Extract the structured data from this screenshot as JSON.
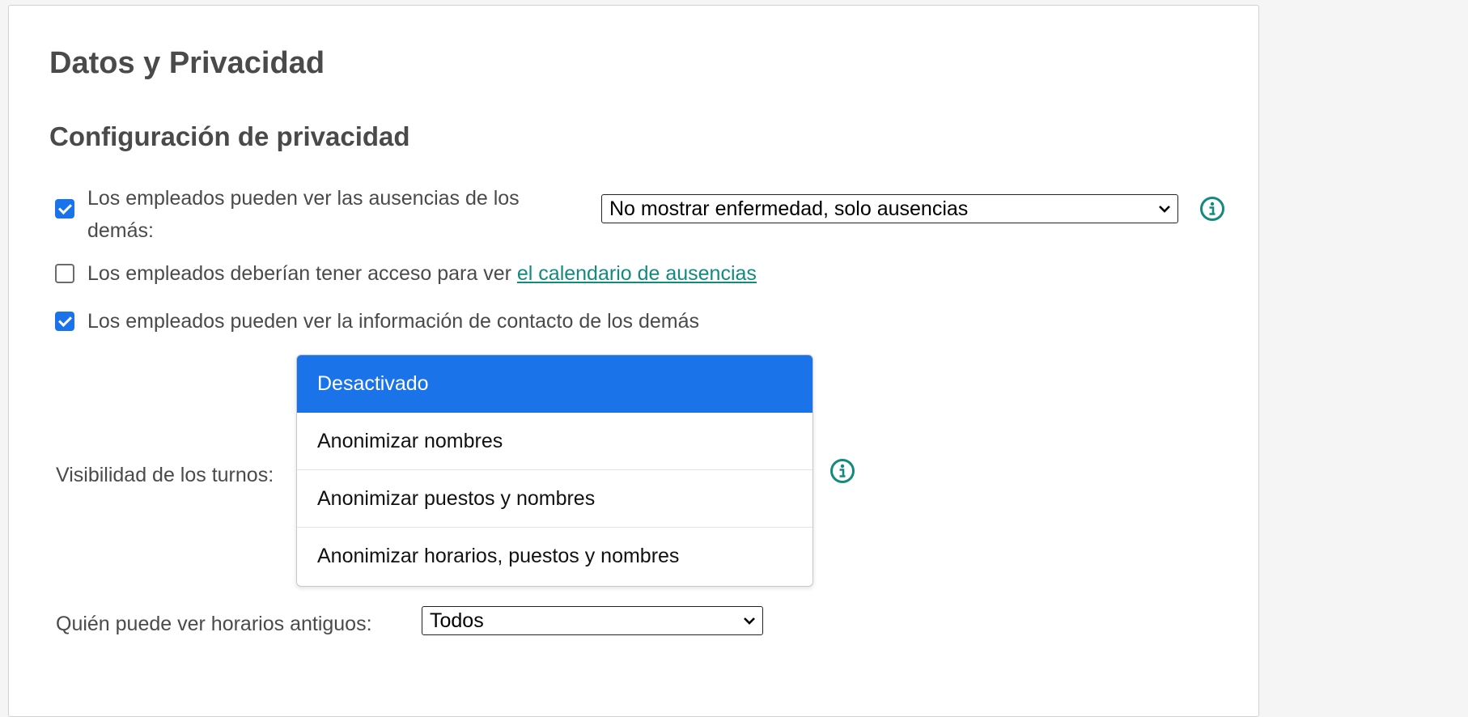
{
  "page": {
    "title": "Datos y Privacidad",
    "section_title": "Configuración de privacidad"
  },
  "settings": {
    "absences": {
      "checked": true,
      "label": "Los empleados pueden ver las ausencias de los demás:",
      "select_value": "No mostrar enfermedad, solo ausencias"
    },
    "calendar_access": {
      "checked": false,
      "label_prefix": "Los empleados deberían tener acceso para ver ",
      "link_text": "el calendario de ausencias"
    },
    "contact_info": {
      "checked": true,
      "label": "Los empleados pueden ver la información de contacto de los demás"
    },
    "shift_visibility": {
      "label": "Visibilidad de los turnos:",
      "options": [
        "Desactivado",
        "Anonimizar nombres",
        "Anonimizar puestos y nombres",
        "Anonimizar horarios, puestos y nombres"
      ],
      "selected": "Desactivado"
    },
    "old_schedules": {
      "label": "Quién puede ver horarios antiguos:",
      "select_value": "Todos"
    }
  },
  "colors": {
    "accent": "#1a73e8",
    "link": "#138a7e",
    "info_icon": "#138a7e",
    "text": "#4a4a4a"
  }
}
